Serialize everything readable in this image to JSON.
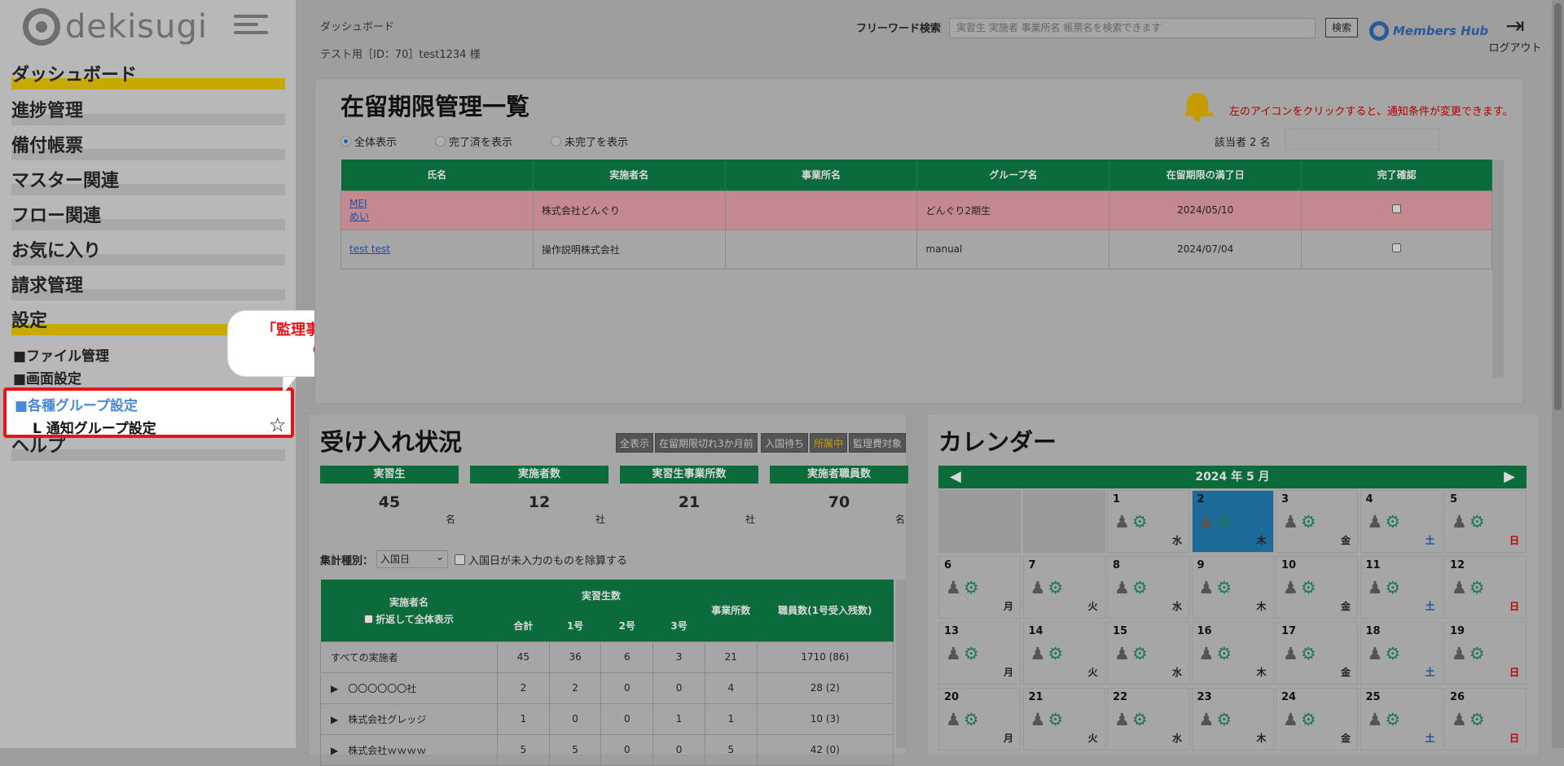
{
  "app": {
    "logo_text": "dekisugi"
  },
  "sidebar": {
    "items": [
      {
        "label": "ダッシュボード"
      },
      {
        "label": "進捗管理"
      },
      {
        "label": "備付帳票"
      },
      {
        "label": "マスター関連"
      },
      {
        "label": "フロー関連"
      },
      {
        "label": "お気に入り"
      },
      {
        "label": "請求管理"
      },
      {
        "label": "設定"
      },
      {
        "label": "ヘルプ"
      }
    ],
    "sub": [
      {
        "label": "■ファイル管理"
      },
      {
        "label": "■画面設定"
      }
    ],
    "highlight": {
      "group": "■各種グループ設定",
      "notice": "L 通知グループ設定"
    }
  },
  "callout": {
    "line1": "「監理事業所グループ設定」",
    "line2": "の表示がない"
  },
  "header": {
    "breadcrumb": "ダッシュボード",
    "user": "テスト用［ID：70］test1234 様",
    "search_label": "フリーワード検索",
    "search_placeholder": "実習生 実施者 事業所名 帳票名を検索できます",
    "search_button": "検索",
    "members_hub": "Members Hub",
    "logout": "ログアウト"
  },
  "residence": {
    "title": "在留期限管理一覧",
    "notice": "左のアイコンをクリックすると、通知条件が変更できます。",
    "filters": [
      "全体表示",
      "完了済を表示",
      "未完了を表示"
    ],
    "count": "該当者 2 名",
    "columns": [
      "氏名",
      "実施者名",
      "事業所名",
      "グループ名",
      "在留期限の満了日",
      "完了確認"
    ],
    "rows": [
      {
        "name1": "MEI",
        "name2": "めい",
        "company": "株式会社どんぐり",
        "office": "",
        "group": "どんぐり2期生",
        "date": "2024/05/10"
      },
      {
        "name1": "test test",
        "name2": "",
        "company": "操作説明株式会社",
        "office": "",
        "group": "manual",
        "date": "2024/07/04"
      }
    ]
  },
  "intake": {
    "title": "受け入れ状況",
    "filter_buttons": [
      "全表示",
      "在留期限切れ3か月前",
      "入国待ち",
      "所属中",
      "監理費対象"
    ],
    "stats": [
      {
        "label": "実習生",
        "value": "45",
        "unit": "名"
      },
      {
        "label": "実施者数",
        "value": "12",
        "unit": "社"
      },
      {
        "label": "実習生事業所数",
        "value": "21",
        "unit": "社"
      },
      {
        "label": "実施者職員数",
        "value": "70",
        "unit": "名"
      }
    ],
    "agg_label": "集計種別：",
    "agg_value": "入国日",
    "exclude_label": "入国日が未入力のものを除算する",
    "table_head": {
      "c1": "実施者名",
      "c1b": "折返して全体表示",
      "trainees": "実習生数",
      "total": "合計",
      "g1": "1号",
      "g2": "2号",
      "g3": "3号",
      "offices": "事業所数",
      "staff": "職員数(1号受入残数)"
    },
    "rows": [
      {
        "name": "すべての実施者",
        "total": "45",
        "g1": "36",
        "g2": "6",
        "g3": "3",
        "offices": "21",
        "staff": "1710 (86)"
      },
      {
        "name": "▶　〇〇〇〇〇〇社",
        "total": "2",
        "g1": "2",
        "g2": "0",
        "g3": "0",
        "offices": "4",
        "staff": "28 (2)"
      },
      {
        "name": "▶　株式会社グレッジ",
        "total": "1",
        "g1": "0",
        "g2": "0",
        "g3": "1",
        "offices": "1",
        "staff": "10 (3)"
      },
      {
        "name": "▶　株式会社ｗｗｗｗ",
        "total": "5",
        "g1": "5",
        "g2": "0",
        "g3": "0",
        "offices": "5",
        "staff": "42 (0)"
      }
    ]
  },
  "calendar": {
    "title": "カレンダー",
    "month": "2024 年 5 月",
    "weeks": [
      [
        {
          "d": "",
          "w": ""
        },
        {
          "d": "",
          "w": ""
        },
        {
          "d": "1",
          "w": "水"
        },
        {
          "d": "2",
          "w": "木"
        },
        {
          "d": "3",
          "w": "金"
        },
        {
          "d": "4",
          "w": "土"
        },
        {
          "d": "5",
          "w": "日"
        }
      ],
      [
        {
          "d": "6",
          "w": "月"
        },
        {
          "d": "7",
          "w": "火"
        },
        {
          "d": "8",
          "w": "水"
        },
        {
          "d": "9",
          "w": "木"
        },
        {
          "d": "10",
          "w": "金"
        },
        {
          "d": "11",
          "w": "土"
        },
        {
          "d": "12",
          "w": "日"
        }
      ],
      [
        {
          "d": "13",
          "w": "月"
        },
        {
          "d": "14",
          "w": "火"
        },
        {
          "d": "15",
          "w": "水"
        },
        {
          "d": "16",
          "w": "木"
        },
        {
          "d": "17",
          "w": "金"
        },
        {
          "d": "18",
          "w": "土"
        },
        {
          "d": "19",
          "w": "日"
        }
      ],
      [
        {
          "d": "20",
          "w": "月"
        },
        {
          "d": "21",
          "w": "火"
        },
        {
          "d": "22",
          "w": "水"
        },
        {
          "d": "23",
          "w": "木"
        },
        {
          "d": "24",
          "w": "金"
        },
        {
          "d": "25",
          "w": "土"
        },
        {
          "d": "26",
          "w": "日"
        }
      ]
    ]
  },
  "colors": {
    "accent_green": "#0b6b3a",
    "highlight_red": "#e8141a",
    "today_blue": "#1c6a9a"
  }
}
